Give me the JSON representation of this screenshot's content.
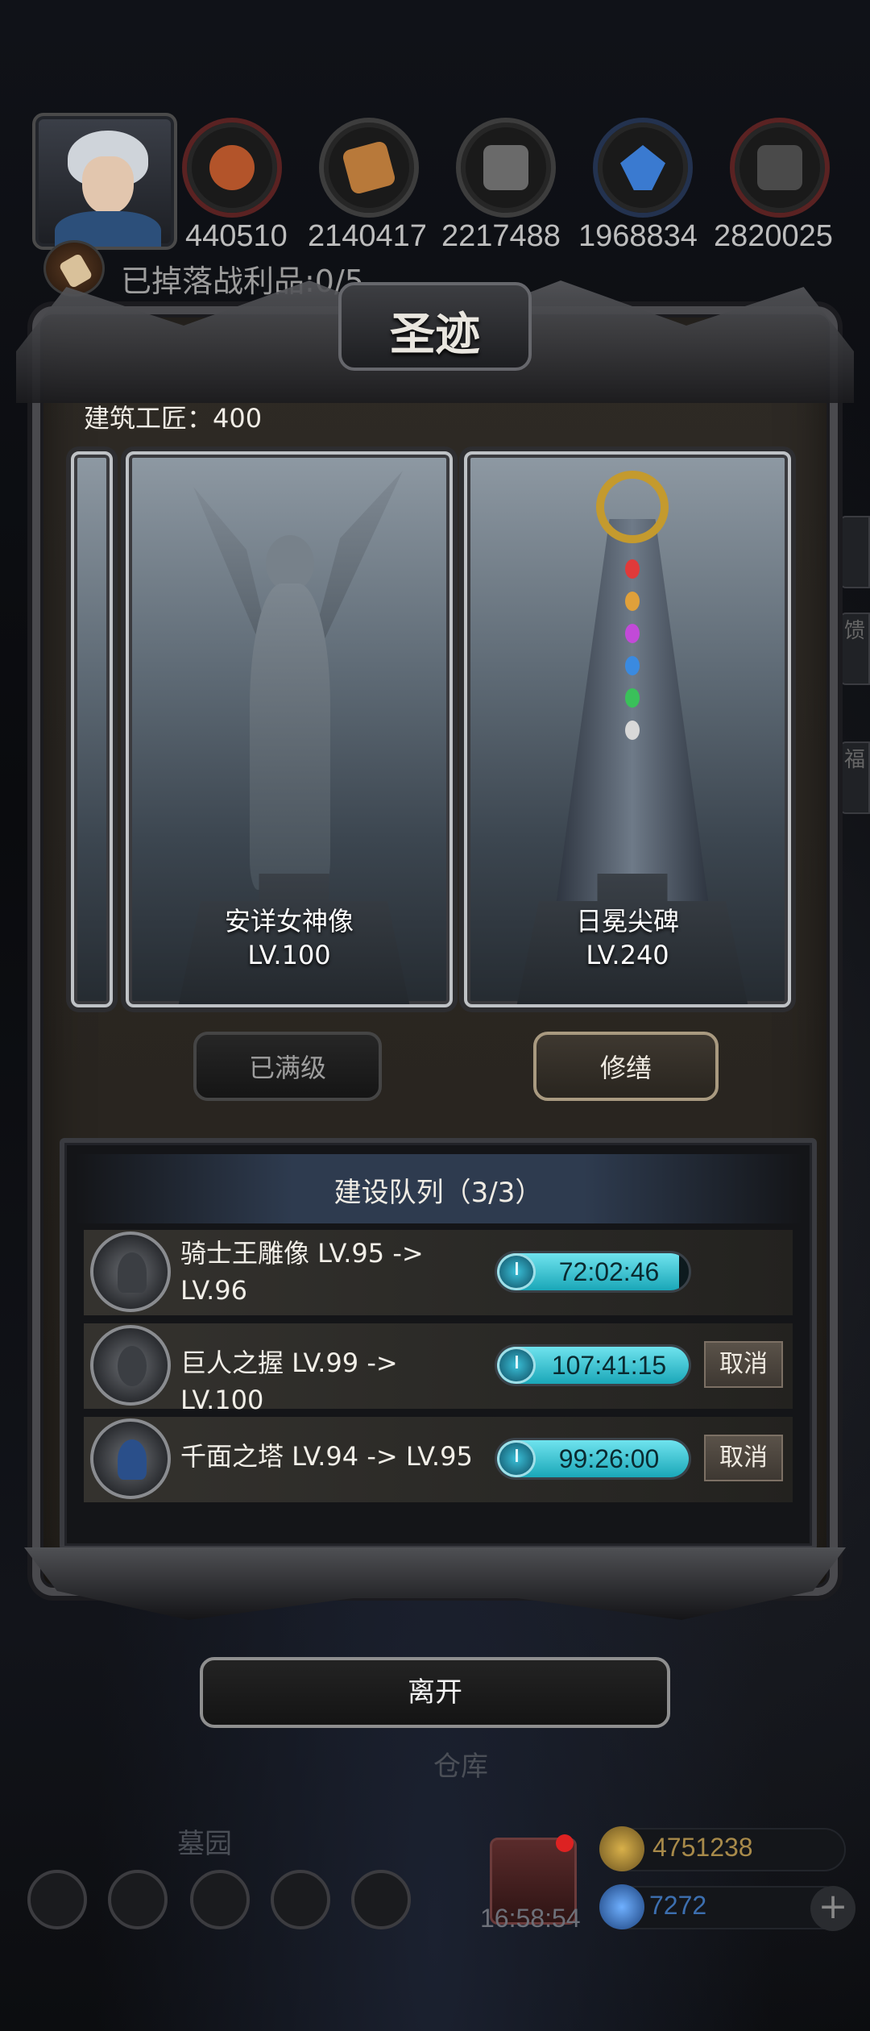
{
  "top_bar": {
    "resources": [
      {
        "name": "meat-icon",
        "value": "440510",
        "color": "#b3542a"
      },
      {
        "name": "wood-icon",
        "value": "2140417",
        "color": "#b8793a"
      },
      {
        "name": "stone-icon",
        "value": "2217488",
        "color": "#6a6a6a"
      },
      {
        "name": "crystal-icon",
        "value": "1968834",
        "color": "#3a7ad0"
      },
      {
        "name": "iron-icon",
        "value": "2820025",
        "color": "#4a4a4a"
      }
    ],
    "loot_text": "已掉落战利品:0/5"
  },
  "dialog": {
    "title": "圣迹",
    "craftsman": "建筑工匠：400",
    "cards": [
      {
        "name": "安详女神像",
        "level": "LV.100",
        "button": "已满级",
        "button_state": "disabled"
      },
      {
        "name": "日冕尖碑",
        "level": "LV.240",
        "button": "修缮",
        "button_state": "active"
      }
    ],
    "queue": {
      "title": "建设队列（3/3）",
      "items": [
        {
          "text": "骑士王雕像 LV.95 -> LV.96",
          "timer": "72:02:46",
          "progress": 0.95,
          "cancel": ""
        },
        {
          "text": "巨人之握 LV.99 -> LV.100",
          "timer": "107:41:15",
          "progress": 1.0,
          "cancel": "取消"
        },
        {
          "text": "千面之塔 LV.94 -> LV.95",
          "timer": "99:26:00",
          "progress": 1.0,
          "cancel": "取消"
        }
      ]
    }
  },
  "leave_button": "离开",
  "background_labels": {
    "warehouse": "仓库",
    "cemetery": "墓园"
  },
  "bottom_bar": {
    "gift_timer": "16:58:54",
    "gold": "4751238",
    "gems": "7272",
    "plus": "+"
  },
  "side_tabs": [
    "馈",
    "福"
  ],
  "colors": {
    "accent_cyan": "#1aa7b8",
    "gold_text": "#a88a4a",
    "gem_text": "#3c6fb0"
  }
}
